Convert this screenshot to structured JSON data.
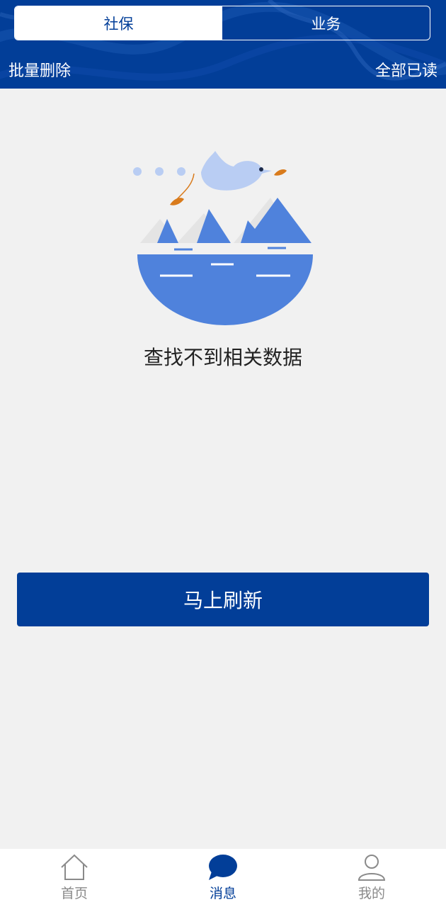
{
  "header": {
    "tabs": [
      {
        "label": "社保",
        "active": true
      },
      {
        "label": "业务",
        "active": false
      }
    ],
    "left_action": "批量删除",
    "right_action": "全部已读"
  },
  "empty_state": {
    "message": "查找不到相关数据",
    "illustration_icon": "bird-mountains-illustration"
  },
  "refresh_button": "马上刷新",
  "tabbar": {
    "items": [
      {
        "label": "首页",
        "icon": "home-icon",
        "active": false
      },
      {
        "label": "消息",
        "icon": "message-icon",
        "active": true
      },
      {
        "label": "我的",
        "icon": "person-icon",
        "active": false
      }
    ]
  },
  "colors": {
    "primary": "#023e98",
    "background": "#f1f1f1",
    "illustration_blue": "#4f82dc",
    "illustration_light": "#b9cdf3",
    "leaf": "#d97b1c"
  }
}
